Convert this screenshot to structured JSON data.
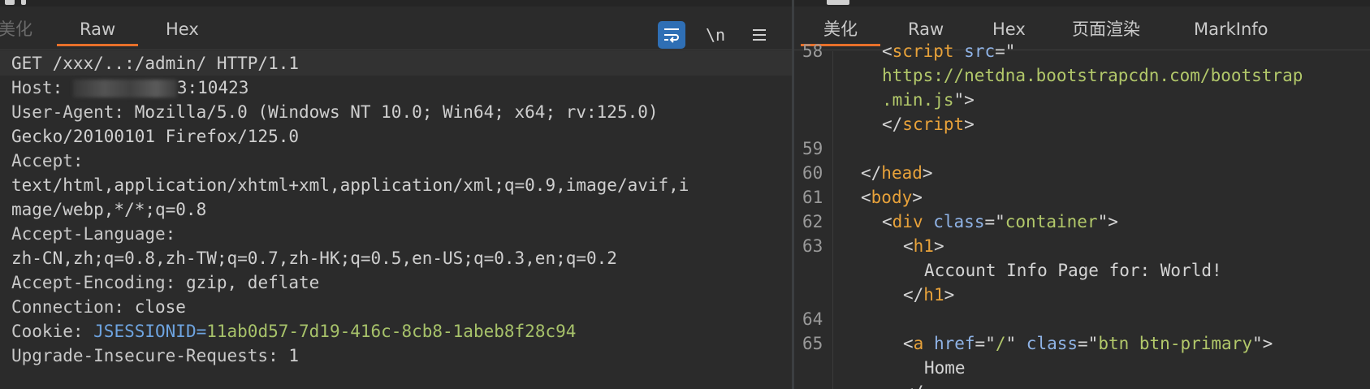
{
  "request_pane": {
    "tabs": [
      {
        "label": "美化",
        "active": false
      },
      {
        "label": "Raw",
        "active": true
      },
      {
        "label": "Hex",
        "active": false
      }
    ],
    "toolbar": {
      "wrap_icon": "wrap-lines-icon",
      "newline_label": "\\n",
      "menu_icon": "hamburger-menu-icon"
    },
    "lines": [
      {
        "kind": "request",
        "text": "GET /xxx/..:/admin/ HTTP/1.1"
      },
      {
        "kind": "host",
        "name": "Host:",
        "value_tail": "3:10423"
      },
      {
        "kind": "header",
        "name": "User-Agent:",
        "value": " Mozilla/5.0 (Windows NT 10.0; Win64; x64; rv:125.0)"
      },
      {
        "kind": "cont",
        "text": "Gecko/20100101 Firefox/125.0"
      },
      {
        "kind": "header",
        "name": "Accept:",
        "value": ""
      },
      {
        "kind": "cont",
        "text": "text/html,application/xhtml+xml,application/xml;q=0.9,image/avif,i"
      },
      {
        "kind": "cont",
        "text": "mage/webp,*/*;q=0.8"
      },
      {
        "kind": "header",
        "name": "Accept-Language:",
        "value": ""
      },
      {
        "kind": "cont",
        "text": "zh-CN,zh;q=0.8,zh-TW;q=0.7,zh-HK;q=0.5,en-US;q=0.3,en;q=0.2"
      },
      {
        "kind": "header",
        "name": "Accept-Encoding:",
        "value": " gzip, deflate"
      },
      {
        "kind": "header",
        "name": "Connection:",
        "value": " close"
      },
      {
        "kind": "cookie",
        "name": "Cookie:",
        "ck_name": " JSESSIONID=",
        "ck_value": "11ab0d57-7d19-416c-8cb8-1abeb8f28c94"
      },
      {
        "kind": "header",
        "name": "Upgrade-Insecure-Requests:",
        "value": " 1"
      }
    ]
  },
  "response_pane": {
    "tabs": [
      {
        "label": "美化",
        "active": true
      },
      {
        "label": "Raw",
        "active": false
      },
      {
        "label": "Hex",
        "active": false
      },
      {
        "label": "页面渲染",
        "active": false
      },
      {
        "label": "MarkInfo",
        "active": false
      }
    ],
    "lines": [
      {
        "num": "58",
        "indent": "  ",
        "parts": [
          [
            "punc",
            "<"
          ],
          [
            "tag",
            "script"
          ],
          [
            "punc",
            " "
          ],
          [
            "attr",
            "src"
          ],
          [
            "punc",
            "=\""
          ]
        ]
      },
      {
        "num": "",
        "indent": "  ",
        "parts": [
          [
            "str",
            "https://netdna.bootstrapcdn.com/bootstrap"
          ]
        ]
      },
      {
        "num": "",
        "indent": "  ",
        "parts": [
          [
            "str",
            ".min.js"
          ],
          [
            "punc",
            "\">"
          ]
        ]
      },
      {
        "num": "",
        "indent": "  ",
        "parts": [
          [
            "punc",
            "</"
          ],
          [
            "tag",
            "script"
          ],
          [
            "punc",
            ">"
          ]
        ]
      },
      {
        "num": "59",
        "indent": "",
        "parts": []
      },
      {
        "num": "60",
        "indent": " ",
        "parts": [
          [
            "punc",
            "</"
          ],
          [
            "tag",
            "head"
          ],
          [
            "punc",
            ">"
          ]
        ]
      },
      {
        "num": "61",
        "indent": " ",
        "parts": [
          [
            "punc",
            "<"
          ],
          [
            "tag",
            "body"
          ],
          [
            "punc",
            ">"
          ]
        ]
      },
      {
        "num": "62",
        "indent": "  ",
        "parts": [
          [
            "punc",
            "<"
          ],
          [
            "tag",
            "div"
          ],
          [
            "punc",
            " "
          ],
          [
            "attr",
            "class"
          ],
          [
            "punc",
            "=\""
          ],
          [
            "str",
            "container"
          ],
          [
            "punc",
            "\">"
          ]
        ]
      },
      {
        "num": "63",
        "indent": "   ",
        "parts": [
          [
            "punc",
            "<"
          ],
          [
            "tag",
            "h1"
          ],
          [
            "punc",
            ">"
          ]
        ]
      },
      {
        "num": "",
        "indent": "    ",
        "parts": [
          [
            "txtc",
            "Account Info Page for: World!"
          ]
        ]
      },
      {
        "num": "",
        "indent": "   ",
        "parts": [
          [
            "punc",
            "</"
          ],
          [
            "tag",
            "h1"
          ],
          [
            "punc",
            ">"
          ]
        ]
      },
      {
        "num": "64",
        "indent": "",
        "parts": []
      },
      {
        "num": "65",
        "indent": "   ",
        "parts": [
          [
            "punc",
            "<"
          ],
          [
            "tag",
            "a"
          ],
          [
            "punc",
            " "
          ],
          [
            "attr",
            "href"
          ],
          [
            "punc",
            "=\""
          ],
          [
            "str",
            "/"
          ],
          [
            "punc",
            "\" "
          ],
          [
            "attr",
            "class"
          ],
          [
            "punc",
            "=\""
          ],
          [
            "str",
            "btn btn-primary"
          ],
          [
            "punc",
            "\">"
          ]
        ]
      },
      {
        "num": "",
        "indent": "    ",
        "parts": [
          [
            "txtc",
            "Home"
          ]
        ]
      },
      {
        "num": "",
        "indent": "   ",
        "parts": [
          [
            "punc",
            "</"
          ]
        ]
      }
    ]
  },
  "colors": {
    "background": "#2b2b2b",
    "accent_underline": "#e8702a",
    "active_tool": "#2f6fb5",
    "tag": "#e8a23a",
    "attribute": "#8fb3e6",
    "string": "#b2c86a",
    "cookie_name": "#6ea4e0",
    "cookie_value": "#a7c26a"
  }
}
